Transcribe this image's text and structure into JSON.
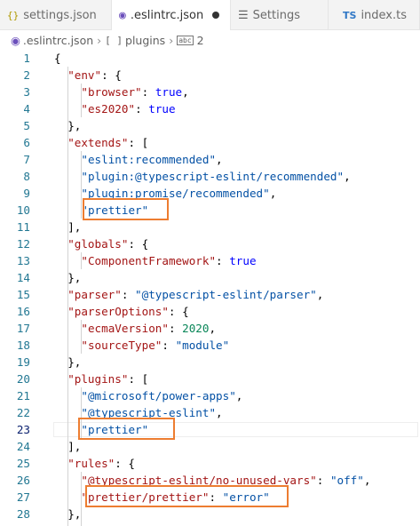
{
  "tabs": [
    {
      "icon": "{}",
      "label": "settings.json"
    },
    {
      "icon": "◉",
      "label": ".eslintrc.json"
    },
    {
      "icon": "☰",
      "label": "Settings"
    },
    {
      "icon": "TS",
      "label": "index.ts"
    }
  ],
  "breadcrumb": {
    "file": ".eslintrc.json",
    "section_icon": "[ ]",
    "section": "plugins",
    "item_icon": "abc",
    "item": "2"
  },
  "lines": [
    {
      "n": "1",
      "ind": 0,
      "t": [
        [
          "p",
          "{"
        ]
      ]
    },
    {
      "n": "2",
      "ind": 1,
      "t": [
        [
          "k",
          "\"env\""
        ],
        [
          "p",
          ": {"
        ]
      ]
    },
    {
      "n": "3",
      "ind": 2,
      "t": [
        [
          "k",
          "\"browser\""
        ],
        [
          "p",
          ": "
        ],
        [
          "b",
          "true"
        ],
        [
          "p",
          ","
        ]
      ]
    },
    {
      "n": "4",
      "ind": 2,
      "t": [
        [
          "k",
          "\"es2020\""
        ],
        [
          "p",
          ": "
        ],
        [
          "b",
          "true"
        ]
      ]
    },
    {
      "n": "5",
      "ind": 1,
      "t": [
        [
          "p",
          "},"
        ]
      ]
    },
    {
      "n": "6",
      "ind": 1,
      "t": [
        [
          "k",
          "\"extends\""
        ],
        [
          "p",
          ": ["
        ]
      ]
    },
    {
      "n": "7",
      "ind": 2,
      "t": [
        [
          "s",
          "\"eslint:recommended\""
        ],
        [
          "p",
          ","
        ]
      ]
    },
    {
      "n": "8",
      "ind": 2,
      "t": [
        [
          "s",
          "\"plugin:@typescript-eslint/recommended\""
        ],
        [
          "p",
          ","
        ]
      ]
    },
    {
      "n": "9",
      "ind": 2,
      "t": [
        [
          "s",
          "\"plugin:promise/recommended\""
        ],
        [
          "p",
          ","
        ]
      ]
    },
    {
      "n": "10",
      "ind": 2,
      "t": [
        [
          "s",
          "\"prettier\""
        ]
      ]
    },
    {
      "n": "11",
      "ind": 1,
      "t": [
        [
          "p",
          "],"
        ]
      ]
    },
    {
      "n": "12",
      "ind": 1,
      "t": [
        [
          "k",
          "\"globals\""
        ],
        [
          "p",
          ": {"
        ]
      ]
    },
    {
      "n": "13",
      "ind": 2,
      "t": [
        [
          "k",
          "\"ComponentFramework\""
        ],
        [
          "p",
          ": "
        ],
        [
          "b",
          "true"
        ]
      ]
    },
    {
      "n": "14",
      "ind": 1,
      "t": [
        [
          "p",
          "},"
        ]
      ]
    },
    {
      "n": "15",
      "ind": 1,
      "t": [
        [
          "k",
          "\"parser\""
        ],
        [
          "p",
          ": "
        ],
        [
          "s",
          "\"@typescript-eslint/parser\""
        ],
        [
          "p",
          ","
        ]
      ]
    },
    {
      "n": "16",
      "ind": 1,
      "t": [
        [
          "k",
          "\"parserOptions\""
        ],
        [
          "p",
          ": {"
        ]
      ]
    },
    {
      "n": "17",
      "ind": 2,
      "t": [
        [
          "k",
          "\"ecmaVersion\""
        ],
        [
          "p",
          ": "
        ],
        [
          "n",
          "2020"
        ],
        [
          "p",
          ","
        ]
      ]
    },
    {
      "n": "18",
      "ind": 2,
      "t": [
        [
          "k",
          "\"sourceType\""
        ],
        [
          "p",
          ": "
        ],
        [
          "s",
          "\"module\""
        ]
      ]
    },
    {
      "n": "19",
      "ind": 1,
      "t": [
        [
          "p",
          "},"
        ]
      ]
    },
    {
      "n": "20",
      "ind": 1,
      "t": [
        [
          "k",
          "\"plugins\""
        ],
        [
          "p",
          ": ["
        ]
      ]
    },
    {
      "n": "21",
      "ind": 2,
      "t": [
        [
          "s",
          "\"@microsoft/power-apps\""
        ],
        [
          "p",
          ","
        ]
      ]
    },
    {
      "n": "22",
      "ind": 2,
      "t": [
        [
          "s",
          "\"@typescript-eslint\""
        ],
        [
          "p",
          ","
        ]
      ]
    },
    {
      "n": "23",
      "ind": 2,
      "t": [
        [
          "s",
          "\"prettier\""
        ]
      ],
      "current": true
    },
    {
      "n": "24",
      "ind": 1,
      "t": [
        [
          "p",
          "],"
        ]
      ]
    },
    {
      "n": "25",
      "ind": 1,
      "t": [
        [
          "k",
          "\"rules\""
        ],
        [
          "p",
          ": {"
        ]
      ]
    },
    {
      "n": "26",
      "ind": 2,
      "t": [
        [
          "k",
          "\"@typescript-eslint/no-unused-vars\""
        ],
        [
          "p",
          ": "
        ],
        [
          "s",
          "\"off\""
        ],
        [
          "p",
          ","
        ]
      ]
    },
    {
      "n": "27",
      "ind": 2,
      "t": [
        [
          "k",
          "\"prettier/prettier\""
        ],
        [
          "p",
          ": "
        ],
        [
          "s",
          "\"error\""
        ]
      ]
    },
    {
      "n": "28",
      "ind": 1,
      "t": [
        [
          "p",
          "},"
        ]
      ]
    }
  ],
  "colors": {
    "key": "#a31515",
    "string": "#0451a5",
    "boolean": "#0000ff",
    "number": "#098658",
    "highlight": "#ed7d31",
    "line_number": "#237893"
  }
}
